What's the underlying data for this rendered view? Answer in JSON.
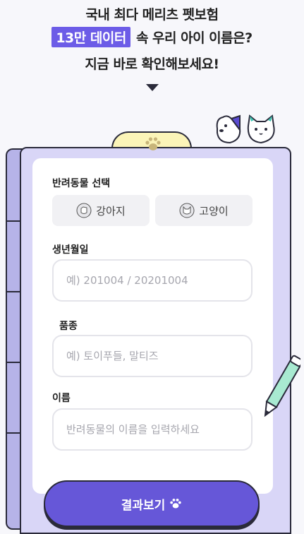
{
  "hero": {
    "line1": "국내 최다 메리츠 펫보험",
    "highlight": "13만 데이터",
    "line2_rest": "속 우리 아이 이름은?",
    "line3": "지금 바로 확인해보세요!"
  },
  "form": {
    "pet_type_label": "반려동물 선택",
    "pet_options": [
      "강아지",
      "고양이"
    ],
    "birth_label": "생년월일",
    "birth_placeholder": "예) 201004 / 20201004",
    "breed_label": "품종",
    "breed_placeholder": "예) 토이푸들, 말티즈",
    "name_label": "이름",
    "name_placeholder": "반려동물의 이름을 입력하세요",
    "submit_label": "결과보기"
  },
  "colors": {
    "accent": "#6657d8",
    "folder": "#d9d6f7",
    "tab": "#fbf4b8"
  },
  "icons": [
    "chevron-down-icon",
    "paw-icon",
    "dog-icon",
    "cat-icon",
    "pencil-icon"
  ]
}
